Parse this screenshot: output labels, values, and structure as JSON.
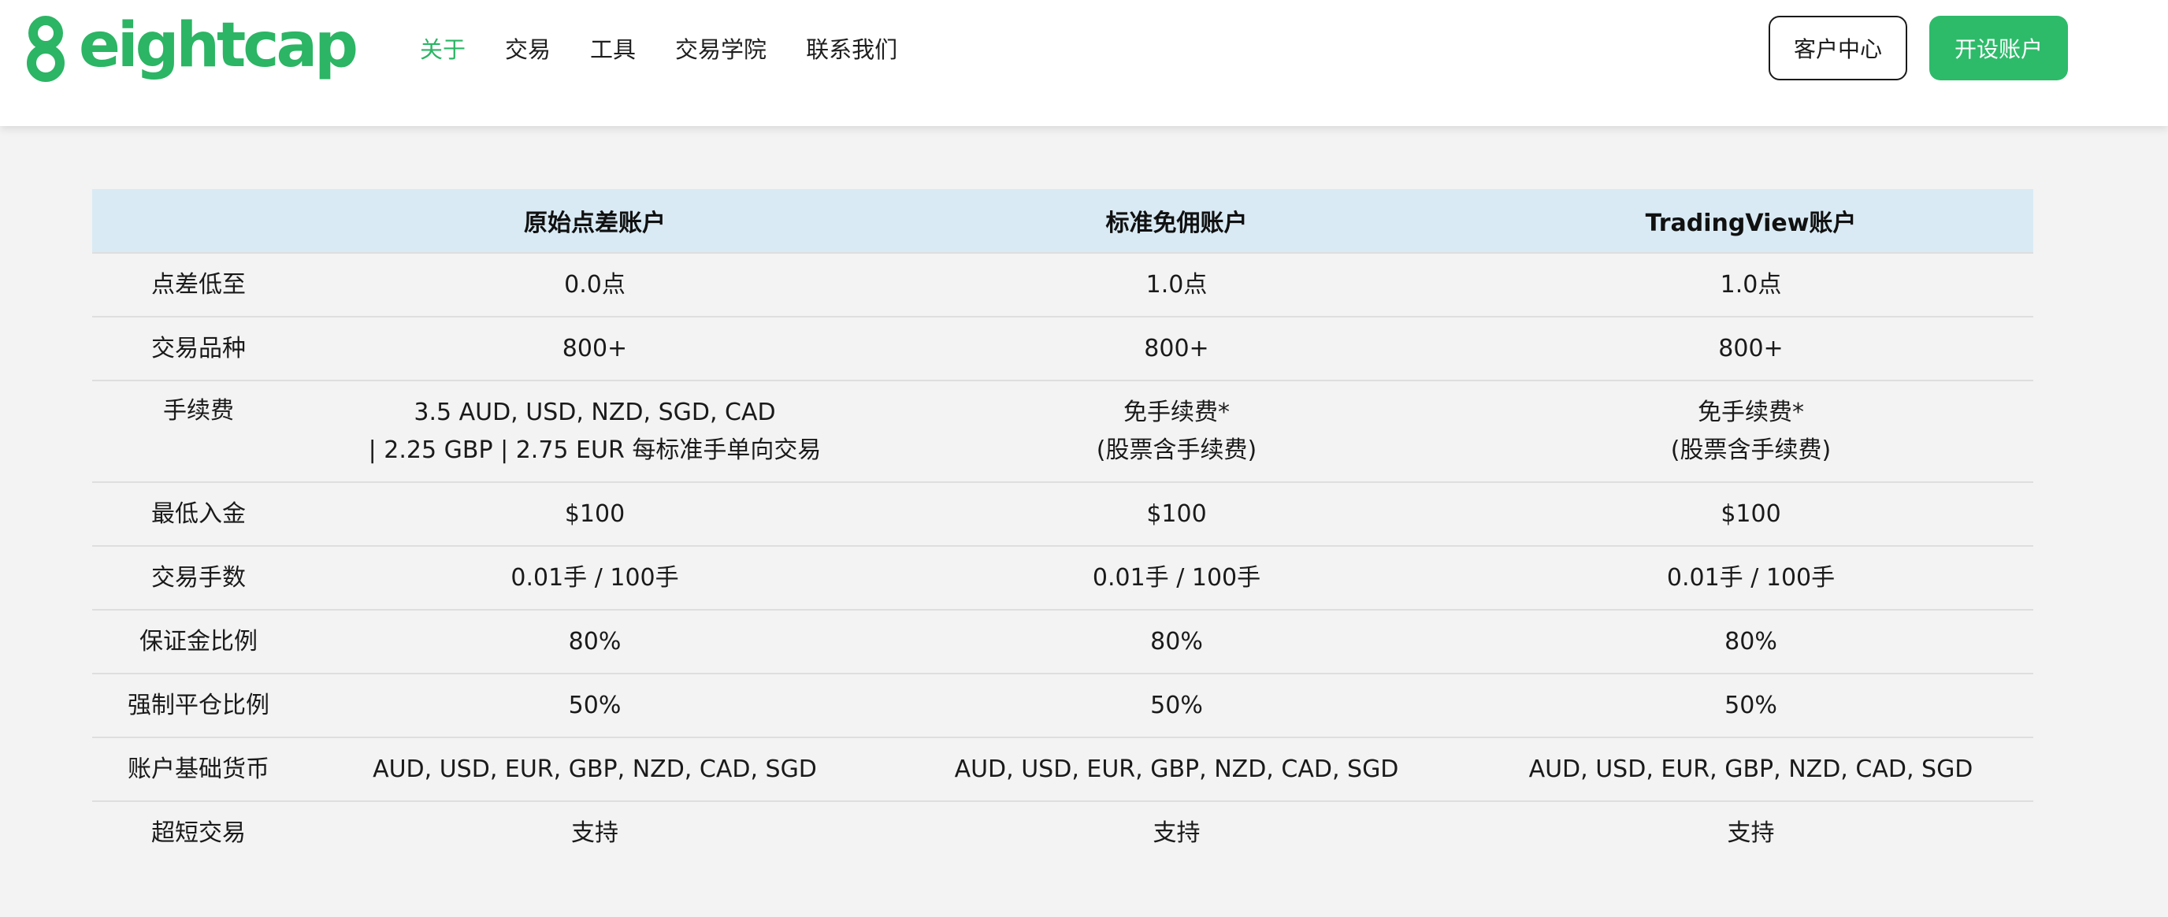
{
  "header": {
    "logo_text": "eightcap",
    "nav": [
      {
        "label": "关于",
        "active": true
      },
      {
        "label": "交易",
        "active": false
      },
      {
        "label": "工具",
        "active": false
      },
      {
        "label": "交易学院",
        "active": false
      },
      {
        "label": "联系我们",
        "active": false
      }
    ],
    "client_center_label": "客户中心",
    "open_account_label": "开设账户"
  },
  "colors": {
    "brand_green": "#2bb564",
    "header_row_bg": "#d9eaf4",
    "page_bg": "#f3f3f3"
  },
  "table": {
    "headers": [
      "",
      "原始点差账户",
      "标准免佣账户",
      "TradingView账户"
    ],
    "rows": [
      {
        "label": "点差低至",
        "cells": [
          [
            "0.0点"
          ],
          [
            "1.0点"
          ],
          [
            "1.0点"
          ]
        ]
      },
      {
        "label": "交易品种",
        "cells": [
          [
            "800+"
          ],
          [
            "800+"
          ],
          [
            "800+"
          ]
        ]
      },
      {
        "label": "手续费",
        "cells": [
          [
            "3.5 AUD, USD, NZD, SGD, CAD",
            "| 2.25 GBP | 2.75 EUR 每标准手单向交易"
          ],
          [
            "免手续费*",
            "(股票含手续费)"
          ],
          [
            "免手续费*",
            "(股票含手续费)"
          ]
        ]
      },
      {
        "label": "最低入金",
        "cells": [
          [
            "$100"
          ],
          [
            "$100"
          ],
          [
            "$100"
          ]
        ]
      },
      {
        "label": "交易手数",
        "cells": [
          [
            "0.01手 / 100手"
          ],
          [
            "0.01手 / 100手"
          ],
          [
            "0.01手 / 100手"
          ]
        ]
      },
      {
        "label": "保证金比例",
        "cells": [
          [
            "80%"
          ],
          [
            "80%"
          ],
          [
            "80%"
          ]
        ]
      },
      {
        "label": "强制平仓比例",
        "cells": [
          [
            "50%"
          ],
          [
            "50%"
          ],
          [
            "50%"
          ]
        ]
      },
      {
        "label": "账户基础货币",
        "cells": [
          [
            "AUD, USD, EUR, GBP, NZD, CAD, SGD"
          ],
          [
            "AUD, USD, EUR, GBP, NZD, CAD, SGD"
          ],
          [
            "AUD, USD, EUR, GBP, NZD, CAD, SGD"
          ]
        ]
      },
      {
        "label": "超短交易",
        "cells": [
          [
            "支持"
          ],
          [
            "支持"
          ],
          [
            "支持"
          ]
        ]
      }
    ]
  }
}
